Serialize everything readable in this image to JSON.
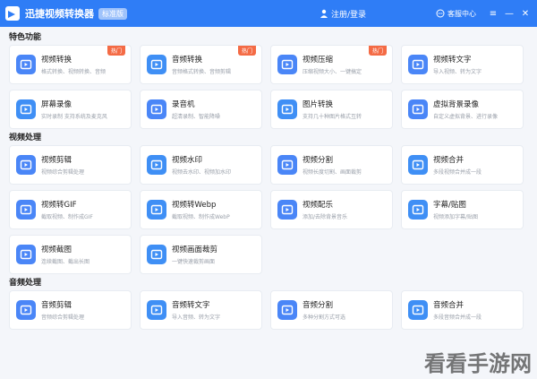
{
  "app": {
    "title": "迅捷视频转换器",
    "badge": "标准版",
    "login": "注册/登录",
    "support": "客服中心",
    "accent": "#2f7df6"
  },
  "sections": [
    {
      "title": "特色功能",
      "items": [
        {
          "title": "视频转换",
          "desc": "格式转换、视频转换、音频",
          "hot": "热门",
          "icon": "video-convert-icon",
          "color": "#4a86f7"
        },
        {
          "title": "音频转换",
          "desc": "音频格式转换、音频剪辑",
          "hot": "热门",
          "icon": "audio-convert-icon",
          "color": "#3f8ff5"
        },
        {
          "title": "视频压缩",
          "desc": "压缩视频大小、一键搞定",
          "hot": "热门",
          "icon": "video-compress-icon",
          "color": "#4a86f7"
        },
        {
          "title": "视频转文字",
          "desc": "导入视频、转为文字",
          "hot": "",
          "icon": "video-to-text-icon",
          "color": "#4a86f7"
        },
        {
          "title": "屏幕录像",
          "desc": "实时录制 支持系统及麦克风",
          "hot": "",
          "icon": "screen-record-icon",
          "color": "#3f8ff5"
        },
        {
          "title": "录音机",
          "desc": "超清录制、智能降噪",
          "hot": "",
          "icon": "recorder-icon",
          "color": "#4a86f7"
        },
        {
          "title": "图片转换",
          "desc": "支持几十种图片格式互转",
          "hot": "",
          "icon": "image-convert-icon",
          "color": "#3f8ff5"
        },
        {
          "title": "虚拟背景录像",
          "desc": "自定义虚拟背景、进行录像",
          "hot": "",
          "icon": "virtual-bg-icon",
          "color": "#4a86f7"
        }
      ]
    },
    {
      "title": "视频处理",
      "items": [
        {
          "title": "视频剪辑",
          "desc": "视频综合剪辑处理",
          "hot": "",
          "icon": "video-edit-icon",
          "color": "#4a86f7"
        },
        {
          "title": "视频水印",
          "desc": "视频去水印、视频加水印",
          "hot": "",
          "icon": "watermark-icon",
          "color": "#3f8ff5"
        },
        {
          "title": "视频分割",
          "desc": "视频长度切割、画面裁剪",
          "hot": "",
          "icon": "video-split-icon",
          "color": "#4a86f7"
        },
        {
          "title": "视频合并",
          "desc": "多段视频合并成一段",
          "hot": "",
          "icon": "video-merge-icon",
          "color": "#3f8ff5"
        },
        {
          "title": "视频转GIF",
          "desc": "截取视频、制作成GIF",
          "hot": "",
          "icon": "gif-icon",
          "color": "#4a86f7"
        },
        {
          "title": "视频转Webp",
          "desc": "截取视频、制作成WebP",
          "hot": "",
          "icon": "webp-icon",
          "color": "#3f8ff5"
        },
        {
          "title": "视频配乐",
          "desc": "添加/去除背景音乐",
          "hot": "",
          "icon": "music-icon",
          "color": "#4a86f7"
        },
        {
          "title": "字幕/贴图",
          "desc": "视频添加字幕/贴图",
          "hot": "",
          "icon": "subtitle-icon",
          "color": "#3f8ff5"
        },
        {
          "title": "视频截图",
          "desc": "连续截图、截出长图",
          "hot": "",
          "icon": "screenshot-icon",
          "color": "#4a86f7"
        },
        {
          "title": "视频画面裁剪",
          "desc": "一键快速裁剪画面",
          "hot": "",
          "icon": "crop-icon",
          "color": "#3f8ff5"
        }
      ]
    },
    {
      "title": "音频处理",
      "items": [
        {
          "title": "音频剪辑",
          "desc": "音频综合剪辑处理",
          "hot": "",
          "icon": "audio-edit-icon",
          "color": "#4a86f7"
        },
        {
          "title": "音频转文字",
          "desc": "导入音频、转为文字",
          "hot": "",
          "icon": "audio-to-text-icon",
          "color": "#3f8ff5"
        },
        {
          "title": "音频分割",
          "desc": "多种分割方式可选",
          "hot": "",
          "icon": "audio-split-icon",
          "color": "#4a86f7"
        },
        {
          "title": "音频合并",
          "desc": "多段音频合并成一段",
          "hot": "",
          "icon": "audio-merge-icon",
          "color": "#3f8ff5"
        }
      ]
    }
  ],
  "watermark": "看看手游网"
}
